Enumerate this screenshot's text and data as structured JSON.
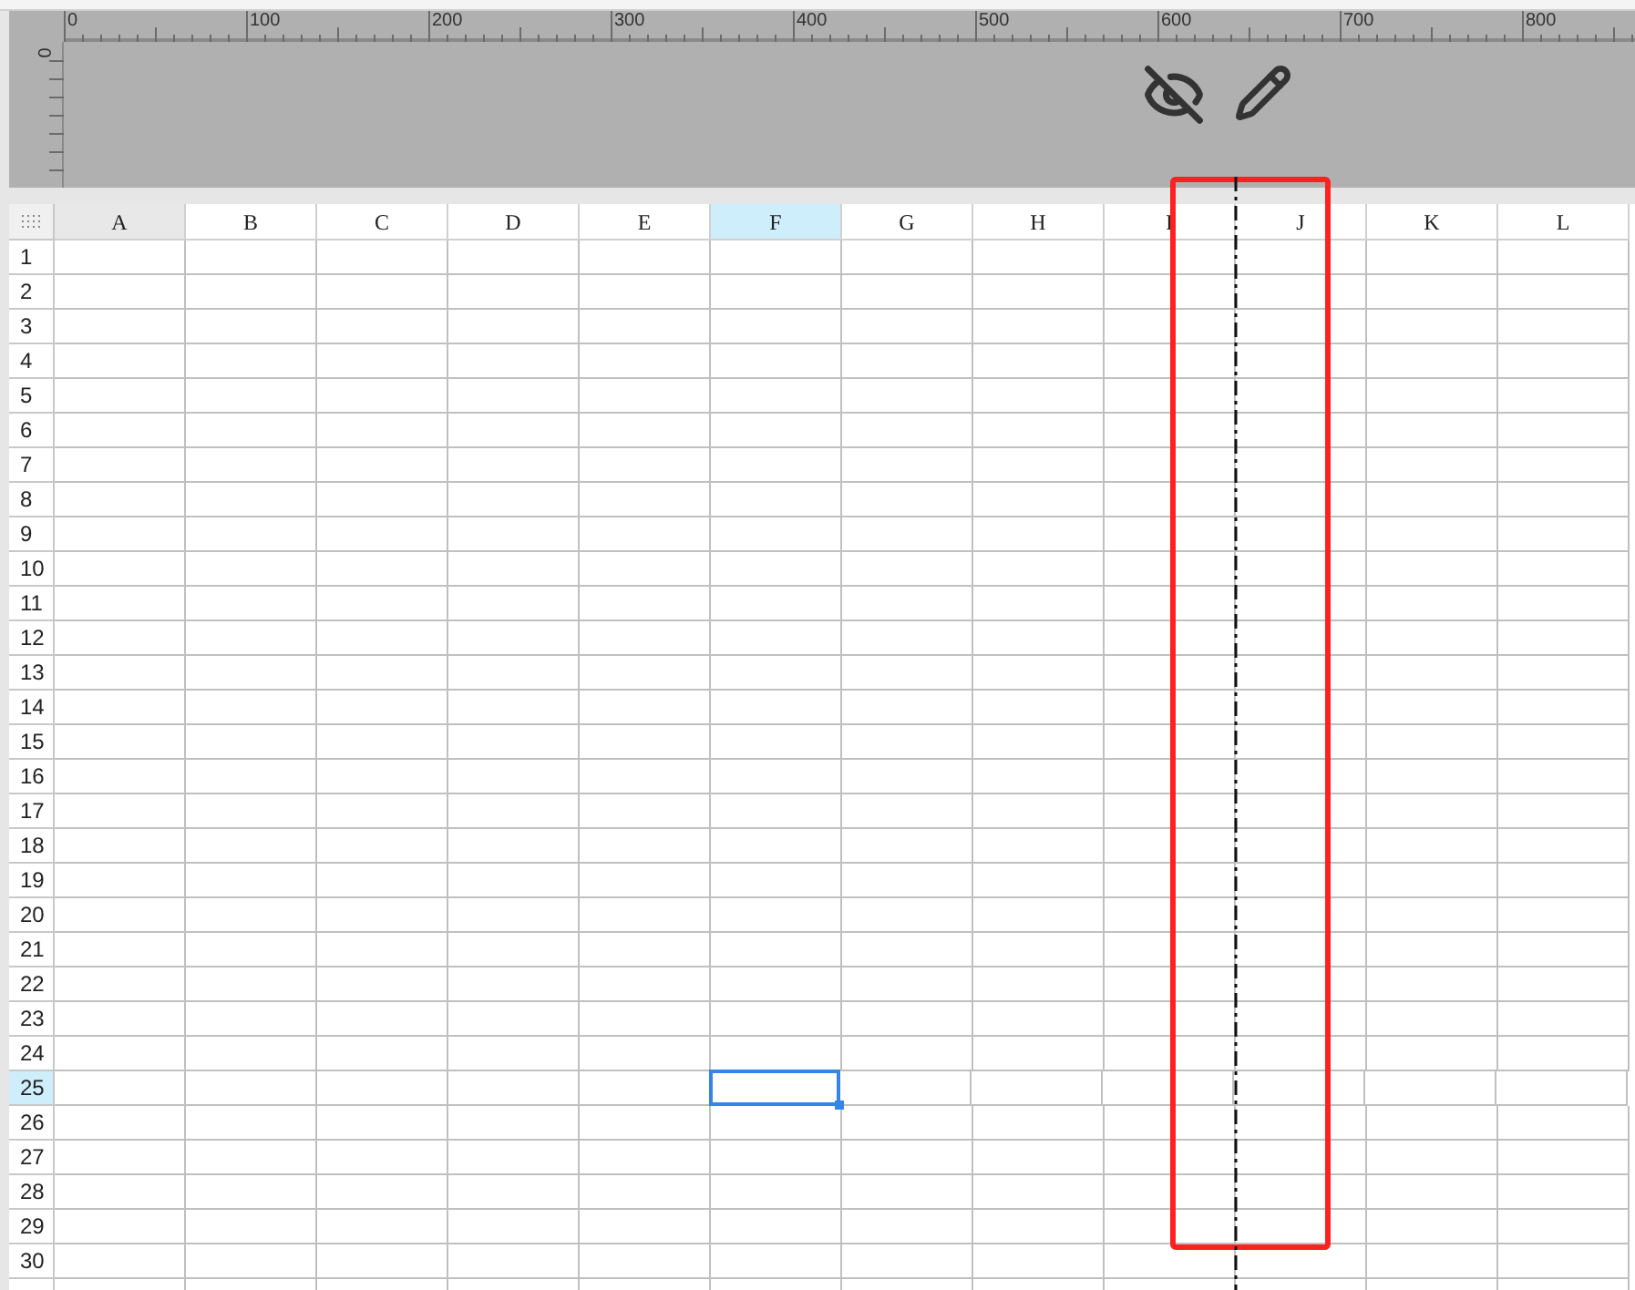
{
  "ruler": {
    "labels": [
      "0",
      "100",
      "200",
      "300",
      "400",
      "500",
      "600",
      "700",
      "800"
    ],
    "vertical_label": "0"
  },
  "columns": [
    {
      "label": "A",
      "selected": false
    },
    {
      "label": "B",
      "selected": false
    },
    {
      "label": "C",
      "selected": false
    },
    {
      "label": "D",
      "selected": false
    },
    {
      "label": "E",
      "selected": false
    },
    {
      "label": "F",
      "selected": true
    },
    {
      "label": "G",
      "selected": false
    },
    {
      "label": "H",
      "selected": false
    },
    {
      "label": "I",
      "selected": false
    },
    {
      "label": "J",
      "selected": false
    },
    {
      "label": "K",
      "selected": false
    },
    {
      "label": "L",
      "selected": false
    }
  ],
  "rows": [
    {
      "label": "1",
      "selected": false
    },
    {
      "label": "2",
      "selected": false
    },
    {
      "label": "3",
      "selected": false
    },
    {
      "label": "4",
      "selected": false
    },
    {
      "label": "5",
      "selected": false
    },
    {
      "label": "6",
      "selected": false
    },
    {
      "label": "7",
      "selected": false
    },
    {
      "label": "8",
      "selected": false
    },
    {
      "label": "9",
      "selected": false
    },
    {
      "label": "10",
      "selected": false
    },
    {
      "label": "11",
      "selected": false
    },
    {
      "label": "12",
      "selected": false
    },
    {
      "label": "13",
      "selected": false
    },
    {
      "label": "14",
      "selected": false
    },
    {
      "label": "15",
      "selected": false
    },
    {
      "label": "16",
      "selected": false
    },
    {
      "label": "17",
      "selected": false
    },
    {
      "label": "18",
      "selected": false
    },
    {
      "label": "19",
      "selected": false
    },
    {
      "label": "20",
      "selected": false
    },
    {
      "label": "21",
      "selected": false
    },
    {
      "label": "22",
      "selected": false
    },
    {
      "label": "23",
      "selected": false
    },
    {
      "label": "24",
      "selected": false
    },
    {
      "label": "25",
      "selected": true
    },
    {
      "label": "26",
      "selected": false
    },
    {
      "label": "27",
      "selected": false
    },
    {
      "label": "28",
      "selected": false
    },
    {
      "label": "29",
      "selected": false
    },
    {
      "label": "30",
      "selected": false
    }
  ]
}
